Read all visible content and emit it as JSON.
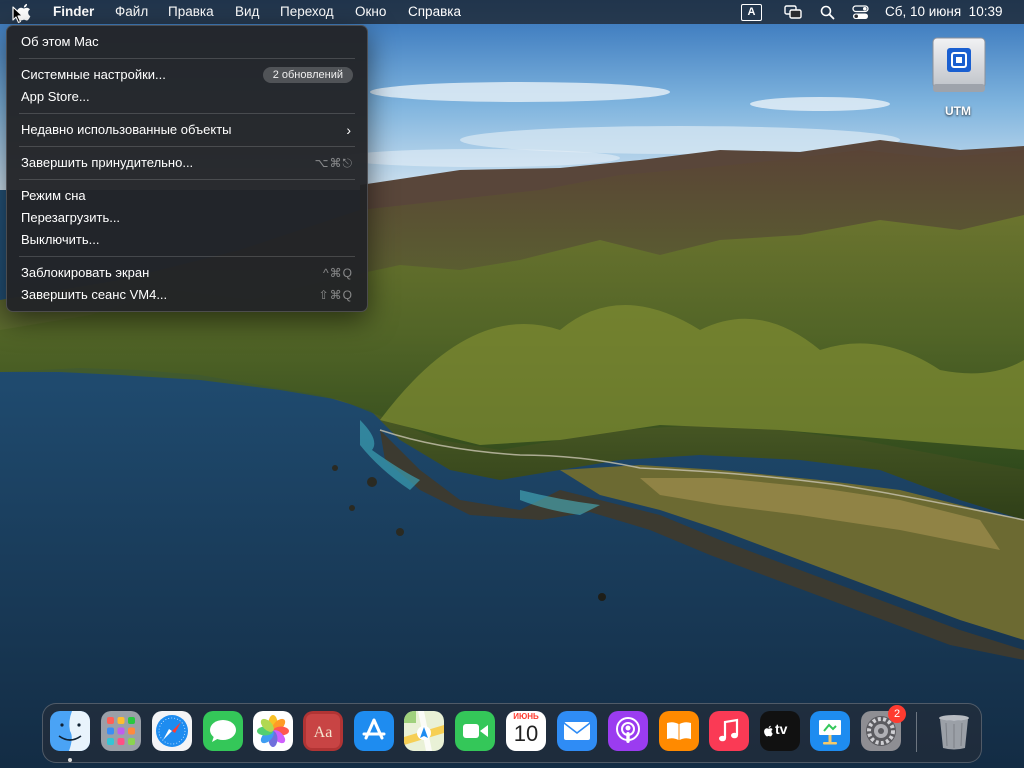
{
  "menubar": {
    "app_name": "Finder",
    "menus": [
      "Файл",
      "Правка",
      "Вид",
      "Переход",
      "Окно",
      "Справка"
    ],
    "input_source": "A",
    "clock": "Сб, 10 июня  10:39",
    "icons": [
      "apple-icon",
      "input-source-icon",
      "screen-mirroring-icon",
      "spotlight-search-icon",
      "control-center-icon"
    ]
  },
  "apple_menu": {
    "about": "Об этом Mac",
    "system_settings": "Системные настройки...",
    "updates_badge": "2 обновлений",
    "app_store": "App Store...",
    "recent_items": "Недавно использованные объекты",
    "force_quit": "Завершить принудительно...",
    "force_quit_shortcut": "⌥⌘⎋",
    "sleep": "Режим сна",
    "restart": "Перезагрузить...",
    "shutdown": "Выключить...",
    "lock_screen": "Заблокировать экран",
    "lock_shortcut": "^⌘Q",
    "logout": "Завершить сеанс VM4...",
    "logout_shortcut": "⇧⌘Q"
  },
  "desktop": {
    "disk_label": "UTM"
  },
  "dock": {
    "apps": [
      "finder",
      "launchpad",
      "safari",
      "messages",
      "photos",
      "dictionary",
      "app-store",
      "maps",
      "facetime",
      "calendar",
      "mail",
      "podcasts",
      "books",
      "music",
      "apple-tv",
      "keynote",
      "system-settings",
      "trash"
    ],
    "calendar_month": "ИЮНЬ",
    "calendar_day": "10",
    "tv_label": "tv",
    "settings_badge": "2"
  },
  "colors": {
    "menubar_bg": "#1c1e22",
    "menu_bg": "#222326",
    "badge_red": "#ff3b30",
    "sky": "#7fb4de",
    "ocean": "#1f4a6e"
  }
}
